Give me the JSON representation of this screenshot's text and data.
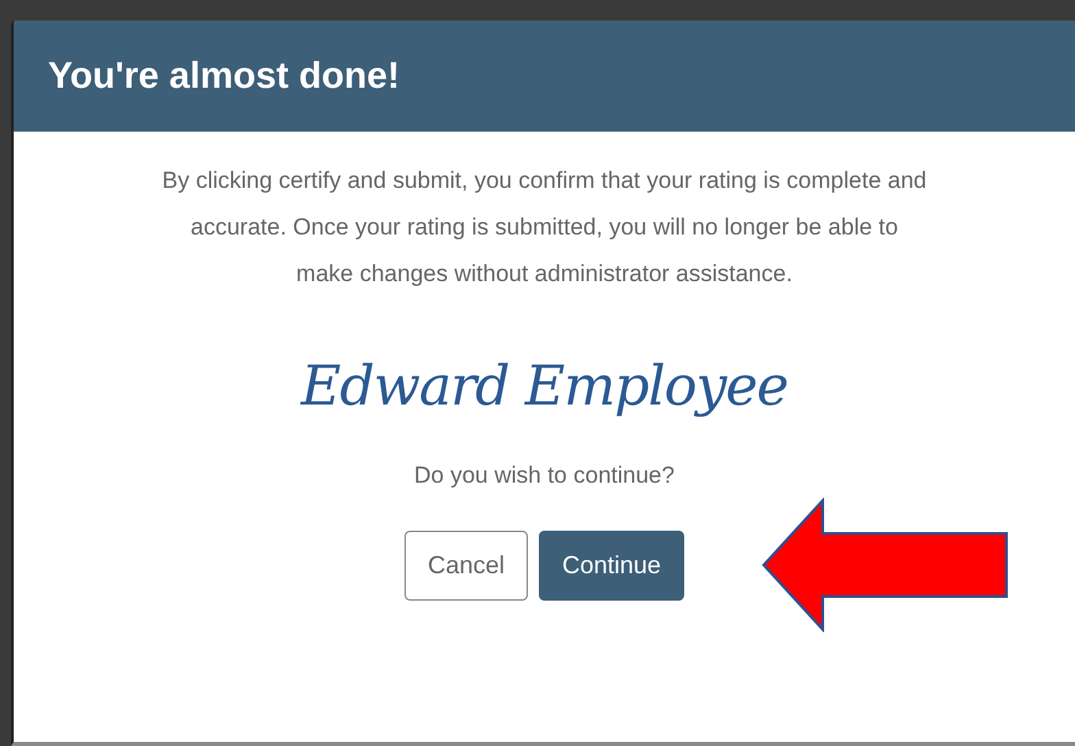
{
  "dialog": {
    "title": "You're almost done!",
    "message": "By clicking certify and submit, you confirm that your rating is complete and accurate. Once your rating is submitted, you will no longer be able to make changes without administrator assistance.",
    "signature": "Edward Employee",
    "prompt": "Do you wish to continue?",
    "buttons": [
      {
        "label": "Cancel",
        "kind": "secondary"
      },
      {
        "label": "Continue",
        "kind": "primary"
      }
    ]
  }
}
